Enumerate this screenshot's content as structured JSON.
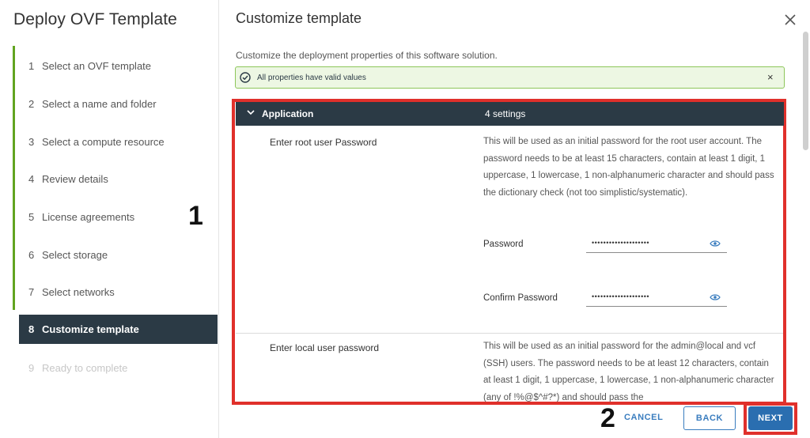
{
  "wizard": {
    "title": "Deploy OVF Template",
    "steps": [
      {
        "num": "1",
        "label": "Select an OVF template"
      },
      {
        "num": "2",
        "label": "Select a name and folder"
      },
      {
        "num": "3",
        "label": "Select a compute resource"
      },
      {
        "num": "4",
        "label": "Review details"
      },
      {
        "num": "5",
        "label": "License agreements"
      },
      {
        "num": "6",
        "label": "Select storage"
      },
      {
        "num": "7",
        "label": "Select networks"
      },
      {
        "num": "8",
        "label": "Customize template"
      },
      {
        "num": "9",
        "label": "Ready to complete"
      }
    ]
  },
  "annotations": {
    "one": "1",
    "two": "2"
  },
  "main": {
    "title": "Customize template",
    "close_icon": "close-icon",
    "subtitle": "Customize the deployment properties of this software solution.",
    "alert": {
      "message": "All properties have valid values",
      "icon": "check-circle-icon",
      "dismiss": "×"
    },
    "section": {
      "name": "Application",
      "count": "4 settings"
    },
    "properties": [
      {
        "label": "Enter root user Password",
        "description": "This will be used as an initial password for the root user account. The password needs to be at least 15 characters, contain at least 1 digit, 1 uppercase, 1 lowercase, 1 non-alphanumeric character and should pass the dictionary check (not too simplistic/systematic).",
        "password_label": "Password",
        "password_value": "••••••••••••••••••••",
        "confirm_label": "Confirm Password",
        "confirm_value": "••••••••••••••••••••"
      },
      {
        "label": "Enter local user password",
        "description": "This will be used as an initial password for the admin@local and vcf (SSH) users. The password needs to be at least 12 characters, contain at least 1 digit, 1 uppercase, 1 lowercase, 1 non-alphanumeric character (any of !%@$^#?*) and should pass the"
      }
    ]
  },
  "footer": {
    "cancel": "CANCEL",
    "back": "BACK",
    "next": "NEXT"
  },
  "colors": {
    "accent": "#2a6eb0",
    "highlight_red": "#e0302b",
    "progress_green": "#62a420",
    "active_step_bg": "#2b3a45"
  }
}
